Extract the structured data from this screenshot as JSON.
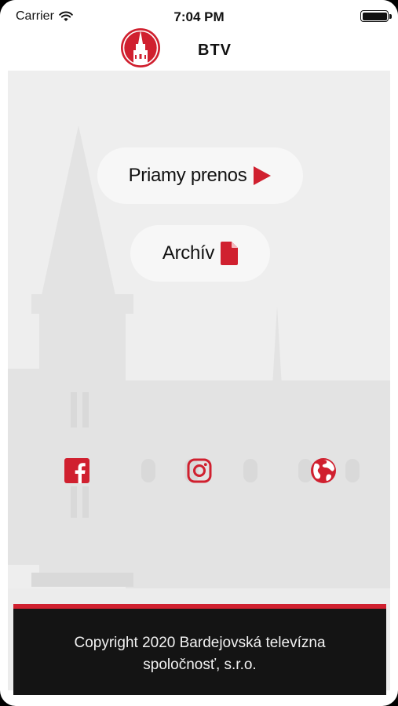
{
  "status_bar": {
    "carrier": "Carrier",
    "time": "7:04 PM"
  },
  "header": {
    "title": "BTV",
    "logo_icon": "btv-tower-logo"
  },
  "main": {
    "live_button_label": "Priamy prenos",
    "live_icon": "play-icon",
    "archive_button_label": "Archív",
    "archive_icon": "document-icon"
  },
  "social": [
    {
      "name": "facebook",
      "icon": "facebook-icon"
    },
    {
      "name": "instagram",
      "icon": "instagram-icon"
    },
    {
      "name": "website",
      "icon": "globe-icon"
    }
  ],
  "footer": {
    "line1": "Copyright 2020 Bardejovská televízna",
    "line2": "spoločnosť, s.r.o."
  },
  "colors": {
    "accent": "#d0202f",
    "footer_bg": "#141414",
    "background": "#eeeeee"
  }
}
